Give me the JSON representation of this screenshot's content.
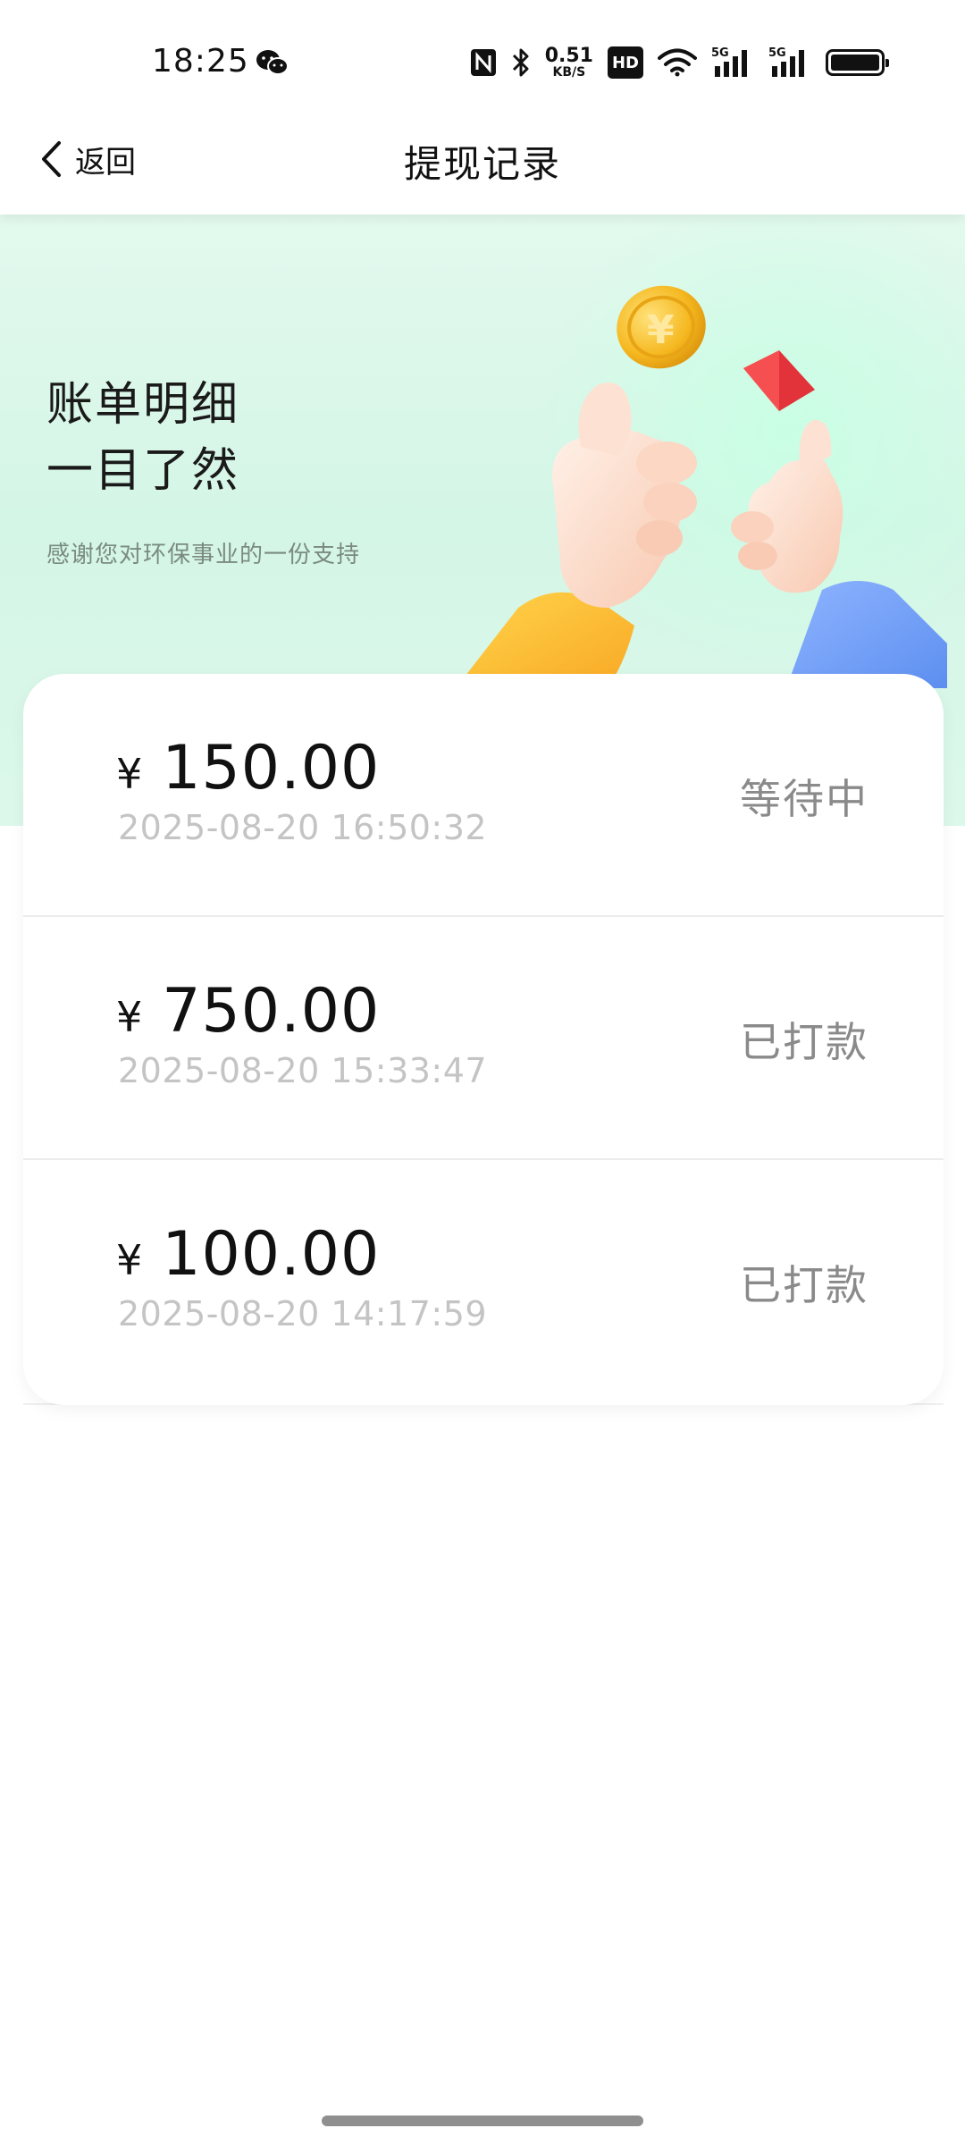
{
  "status_bar": {
    "time": "18:25",
    "icons": [
      "wechat-icon",
      "nfc-icon",
      "bluetooth-icon",
      "wifi-icon",
      "signal-5g-icon",
      "signal-5g-icon",
      "battery-icon"
    ],
    "net_speed_value": "0.51",
    "net_speed_unit": "KB/S",
    "hd_label": "HD",
    "signal_label": "5G"
  },
  "nav": {
    "back_label": "返回",
    "title": "提现记录"
  },
  "banner": {
    "title_line1": "账单明细",
    "title_line2": "一目了然",
    "subtitle": "感谢您对环保事业的一份支持",
    "coin_symbol": "¥"
  },
  "records": [
    {
      "currency": "¥",
      "amount": "150.00",
      "time": "2025-08-20 16:50:32",
      "status": "等待中"
    },
    {
      "currency": "¥",
      "amount": "750.00",
      "time": "2025-08-20 15:33:47",
      "status": "已打款"
    },
    {
      "currency": "¥",
      "amount": "100.00",
      "time": "2025-08-20 14:17:59",
      "status": "已打款"
    }
  ],
  "colors": {
    "banner_bg": "#d4f6e6",
    "status_text": "#8a8a8a",
    "time_text": "#c4c4c4",
    "coin_gold": "#f5b820"
  }
}
